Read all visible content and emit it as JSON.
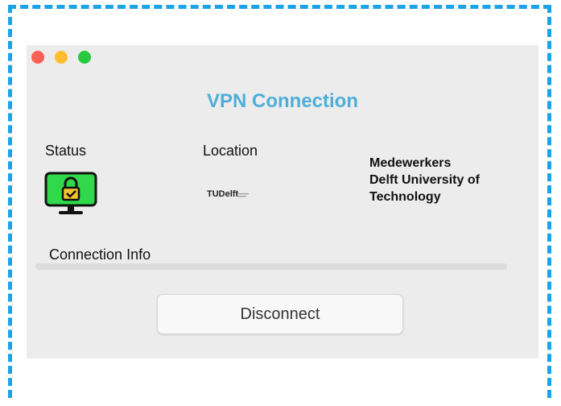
{
  "window": {
    "title": "VPN Connection",
    "status_label": "Status",
    "location_label": "Location",
    "location_logo_text": "TUDelft",
    "organization": "Medewerkers Delft University of Technology",
    "connection_info_label": "Connection Info",
    "disconnect_label": "Disconnect",
    "status_icon": "monitor-lock-icon"
  },
  "colors": {
    "accent": "#4eaed8",
    "monitor_screen": "#2fd94a",
    "frame_dash": "#1aa3e8"
  }
}
